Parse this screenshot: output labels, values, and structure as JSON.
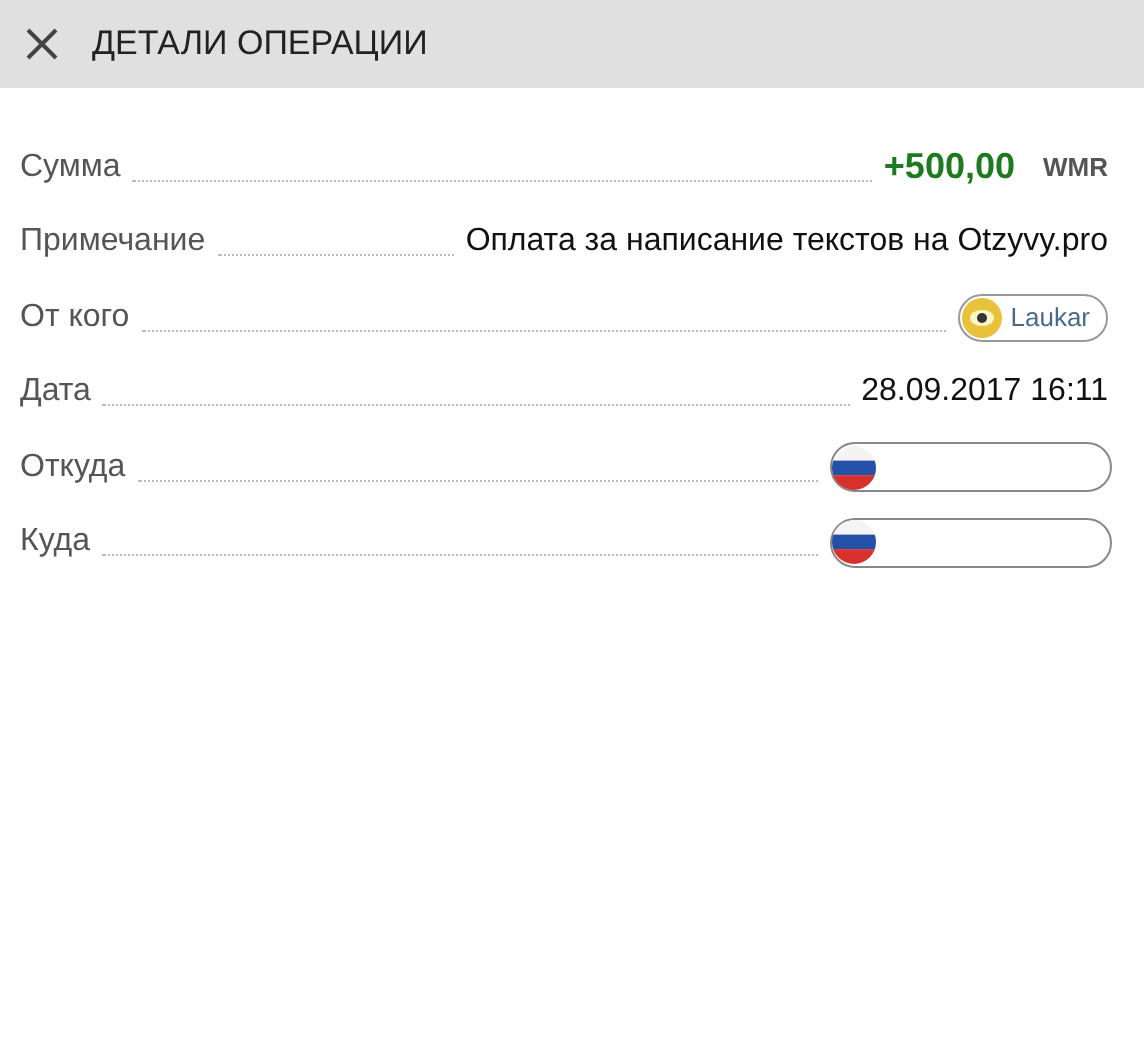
{
  "header": {
    "title": "ДЕТАЛИ ОПЕРАЦИИ"
  },
  "rows": [
    {
      "label": "Сумма",
      "kind": "amount",
      "value": "+500,00",
      "currency": "WMR"
    },
    {
      "label": "Примечание",
      "kind": "text",
      "value": "Оплата за написание текстов на Otzyvy.pro"
    },
    {
      "label": "От кого",
      "kind": "user",
      "value": "Laukar"
    },
    {
      "label": "Дата",
      "kind": "text",
      "value": "28.09.2017 16:11"
    },
    {
      "label": "Откуда",
      "kind": "wallet"
    },
    {
      "label": "Куда",
      "kind": "wallet"
    }
  ]
}
